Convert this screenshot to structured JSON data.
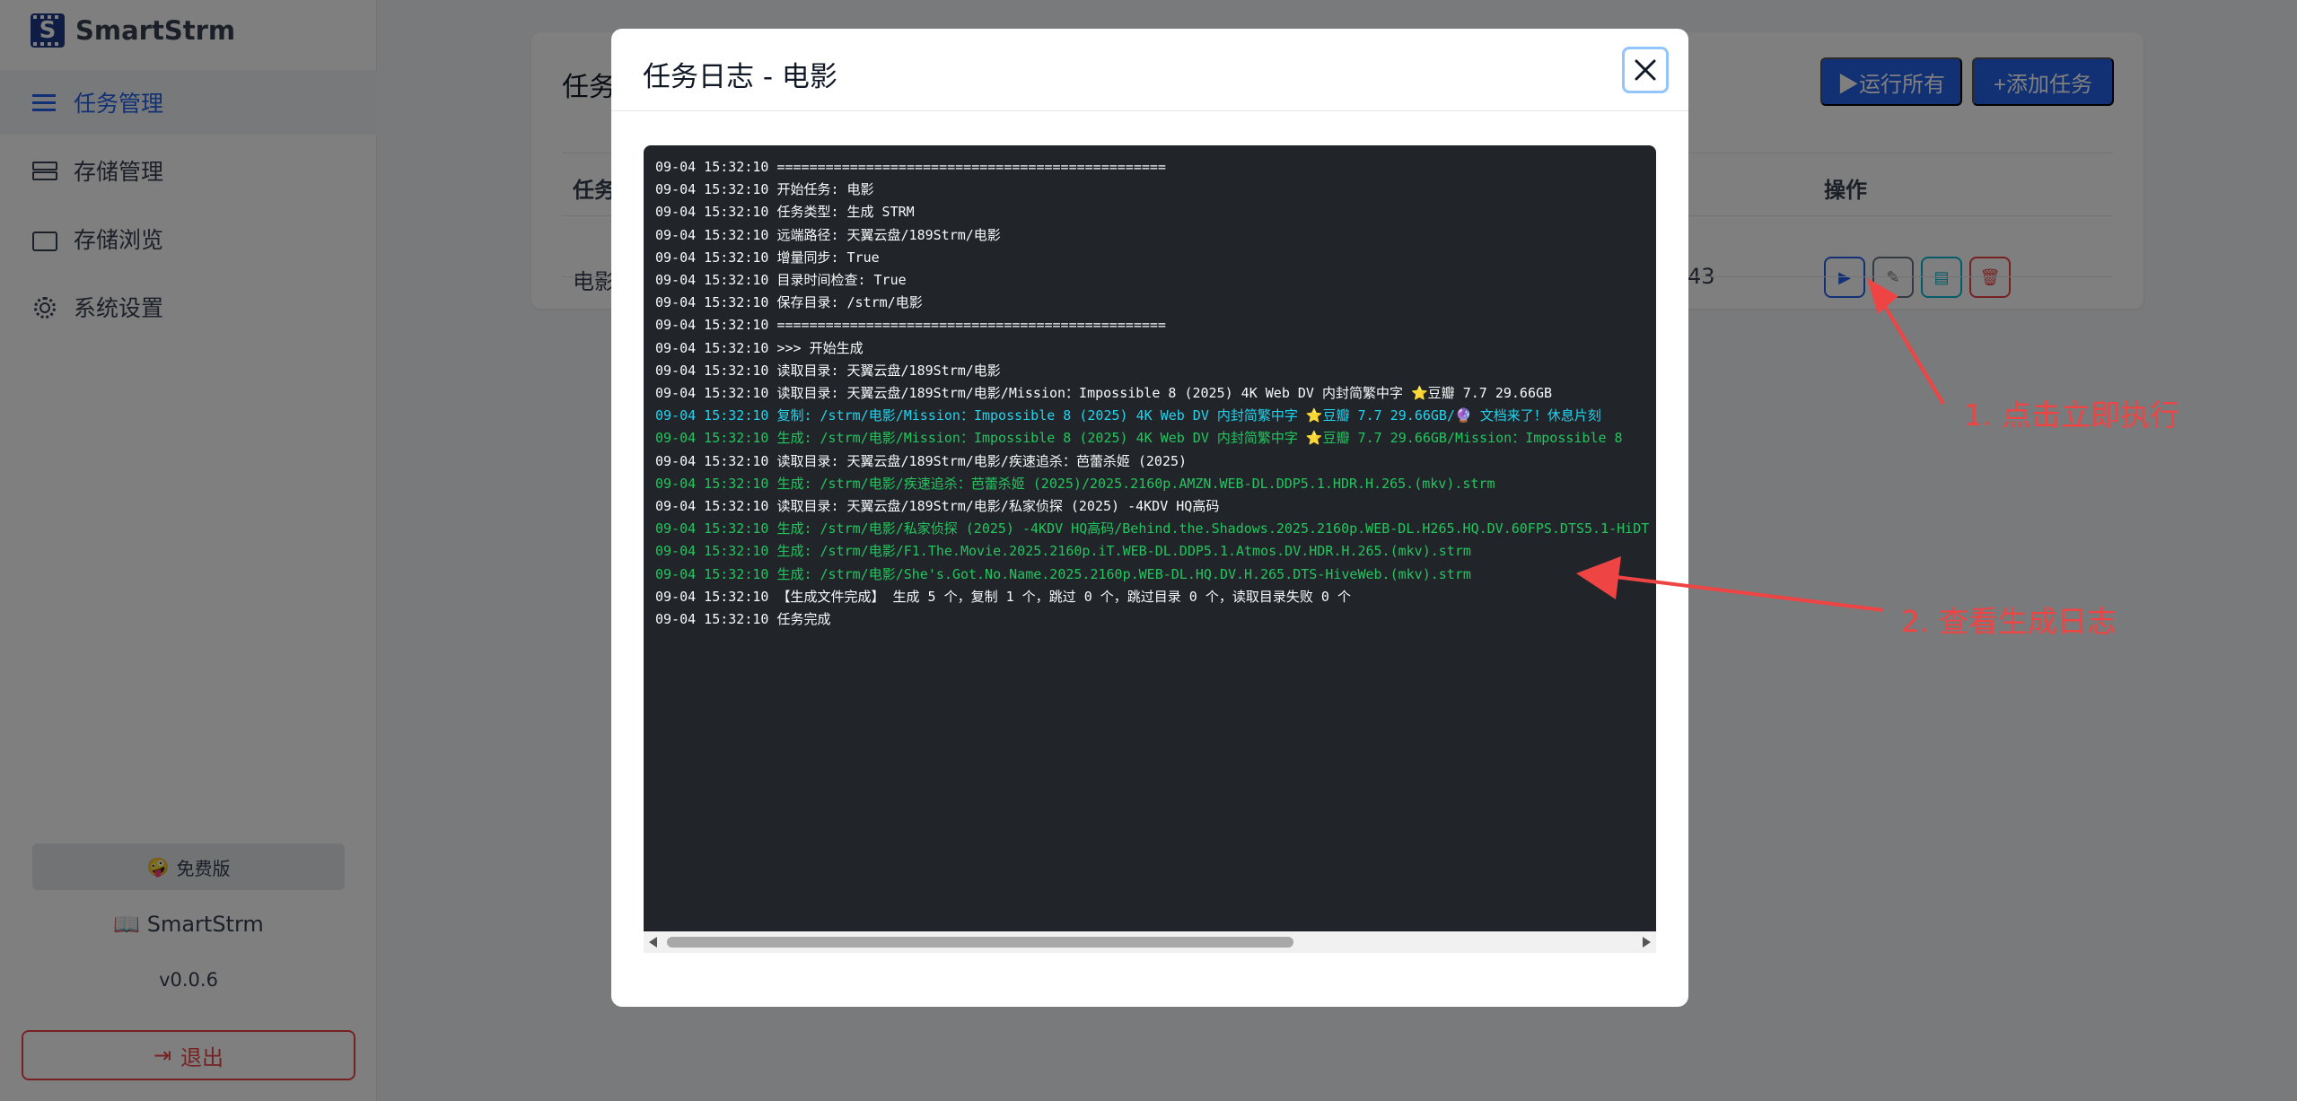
{
  "brand": {
    "name": "SmartStrm",
    "logo_letter": "S"
  },
  "sidebar": {
    "items": [
      {
        "label": "任务管理",
        "icon": "list-icon",
        "active": true
      },
      {
        "label": "存储管理",
        "icon": "storage-icon",
        "active": false
      },
      {
        "label": "存储浏览",
        "icon": "folder-icon",
        "active": false
      },
      {
        "label": "系统设置",
        "icon": "gear-icon",
        "active": false
      }
    ],
    "edition": "免费版",
    "edition_emoji": "🤪",
    "app_name": "SmartStrm",
    "version": "v0.0.6",
    "logout": "退出"
  },
  "main": {
    "title": "任务",
    "run_all": "▶运行所有",
    "add_task": "+添加任务",
    "headers": {
      "task": "任务",
      "actions": "操作"
    },
    "row": {
      "name": "电影",
      "col_end": "43"
    }
  },
  "modal": {
    "title": "任务日志 - 电影",
    "log_lines": [
      {
        "text": "09-04 15:32:10 ================================================",
        "color": "white"
      },
      {
        "text": "09-04 15:32:10 开始任务: 电影",
        "color": "white"
      },
      {
        "text": "09-04 15:32:10 任务类型: 生成 STRM",
        "color": "white"
      },
      {
        "text": "09-04 15:32:10 远端路径: 天翼云盘/189Strm/电影",
        "color": "white"
      },
      {
        "text": "09-04 15:32:10 增量同步: True",
        "color": "white"
      },
      {
        "text": "09-04 15:32:10 目录时间检查: True",
        "color": "white"
      },
      {
        "text": "09-04 15:32:10 保存目录: /strm/电影",
        "color": "white"
      },
      {
        "text": "09-04 15:32:10 ================================================",
        "color": "white"
      },
      {
        "text": "09-04 15:32:10 >>> 开始生成",
        "color": "white"
      },
      {
        "text": "09-04 15:32:10 读取目录: 天翼云盘/189Strm/电影",
        "color": "white"
      },
      {
        "text": "09-04 15:32:10 读取目录: 天翼云盘/189Strm/电影/Mission：Impossible 8 (2025) 4K Web DV 内封简繁中字 ⭐豆瓣 7.7 29.66GB",
        "color": "white"
      },
      {
        "text": "09-04 15:32:10 复制: /strm/电影/Mission：Impossible 8 (2025) 4K Web DV 内封简繁中字 ⭐豆瓣 7.7 29.66GB/🔮 文档来了！休息片刻",
        "color": "cyan"
      },
      {
        "text": "09-04 15:32:10 生成: /strm/电影/Mission：Impossible 8 (2025) 4K Web DV 内封简繁中字 ⭐豆瓣 7.7 29.66GB/Mission：Impossible 8",
        "color": "green"
      },
      {
        "text": "09-04 15:32:10 读取目录: 天翼云盘/189Strm/电影/疾速追杀：芭蕾杀姬 (2025)",
        "color": "white"
      },
      {
        "text": "09-04 15:32:10 生成: /strm/电影/疾速追杀：芭蕾杀姬 (2025)/2025.2160p.AMZN.WEB-DL.DDP5.1.HDR.H.265.(mkv).strm",
        "color": "green"
      },
      {
        "text": "09-04 15:32:10 读取目录: 天翼云盘/189Strm/电影/私家侦探 (2025) -4KDV HQ高码",
        "color": "white"
      },
      {
        "text": "09-04 15:32:10 生成: /strm/电影/私家侦探 (2025) -4KDV HQ高码/Behind.the.Shadows.2025.2160p.WEB-DL.H265.HQ.DV.60FPS.DTS5.1-HiDT",
        "color": "green"
      },
      {
        "text": "09-04 15:32:10 生成: /strm/电影/F1.The.Movie.2025.2160p.iT.WEB-DL.DDP5.1.Atmos.DV.HDR.H.265.(mkv).strm",
        "color": "green"
      },
      {
        "text": "09-04 15:32:10 生成: /strm/电影/She's.Got.No.Name.2025.2160p.WEB-DL.HQ.DV.H.265.DTS-HiveWeb.(mkv).strm",
        "color": "green"
      },
      {
        "text": "09-04 15:32:10 【生成文件完成】 生成 5 个，复制 1 个，跳过 0 个，跳过目录 0 个，读取目录失败 0 个",
        "color": "white"
      },
      {
        "text": "09-04 15:32:10 任务完成",
        "color": "white"
      }
    ]
  },
  "annotations": {
    "step1": "1. 点击立即执行",
    "step2": "2. 查看生成日志"
  },
  "colors": {
    "primary": "#2563eb",
    "danger": "#ef4444",
    "log_bg": "#212529",
    "log_cyan": "#22d3ee",
    "log_green": "#22c55e",
    "annotation": "#ef4444"
  }
}
